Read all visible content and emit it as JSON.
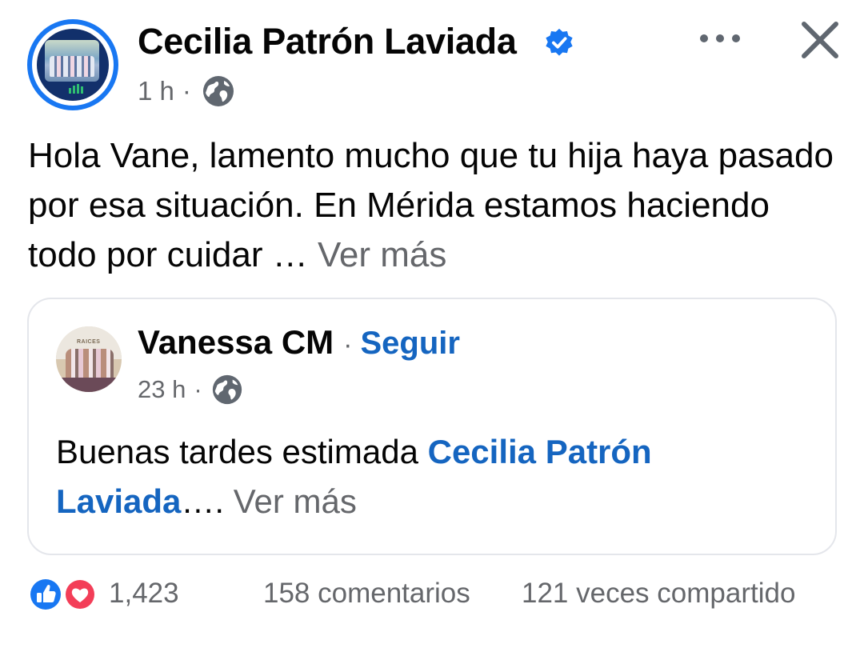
{
  "post": {
    "author": "Cecilia Patrón Laviada",
    "time": "1 h",
    "separator": "·",
    "privacy_icon": "globe-icon",
    "body": "Hola Vane, lamento mucho que tu hija haya pasado por esa situación. En Mérida estamos haciendo todo por cuidar … ",
    "see_more": "Ver más"
  },
  "shared": {
    "author": "Vanessa CM",
    "separator": "·",
    "follow_label": "Seguir",
    "time": "23 h",
    "privacy_icon": "globe-icon",
    "avatar_text": "RAICES",
    "text_before": "Buenas tardes estimada ",
    "mention": "Cecilia Patrón Laviada",
    "ellipsis": "…. ",
    "see_more": "Ver más"
  },
  "stats": {
    "reactions_count": "1,423",
    "comments": "158 comentarios",
    "shares": "121 veces compartido",
    "reaction_icons": [
      "like-icon",
      "love-icon"
    ]
  },
  "colors": {
    "accent": "#1877f2",
    "link": "#1565c0",
    "secondary_text": "#65676b",
    "love": "#f33e58",
    "card_border": "#e4e6eb"
  }
}
